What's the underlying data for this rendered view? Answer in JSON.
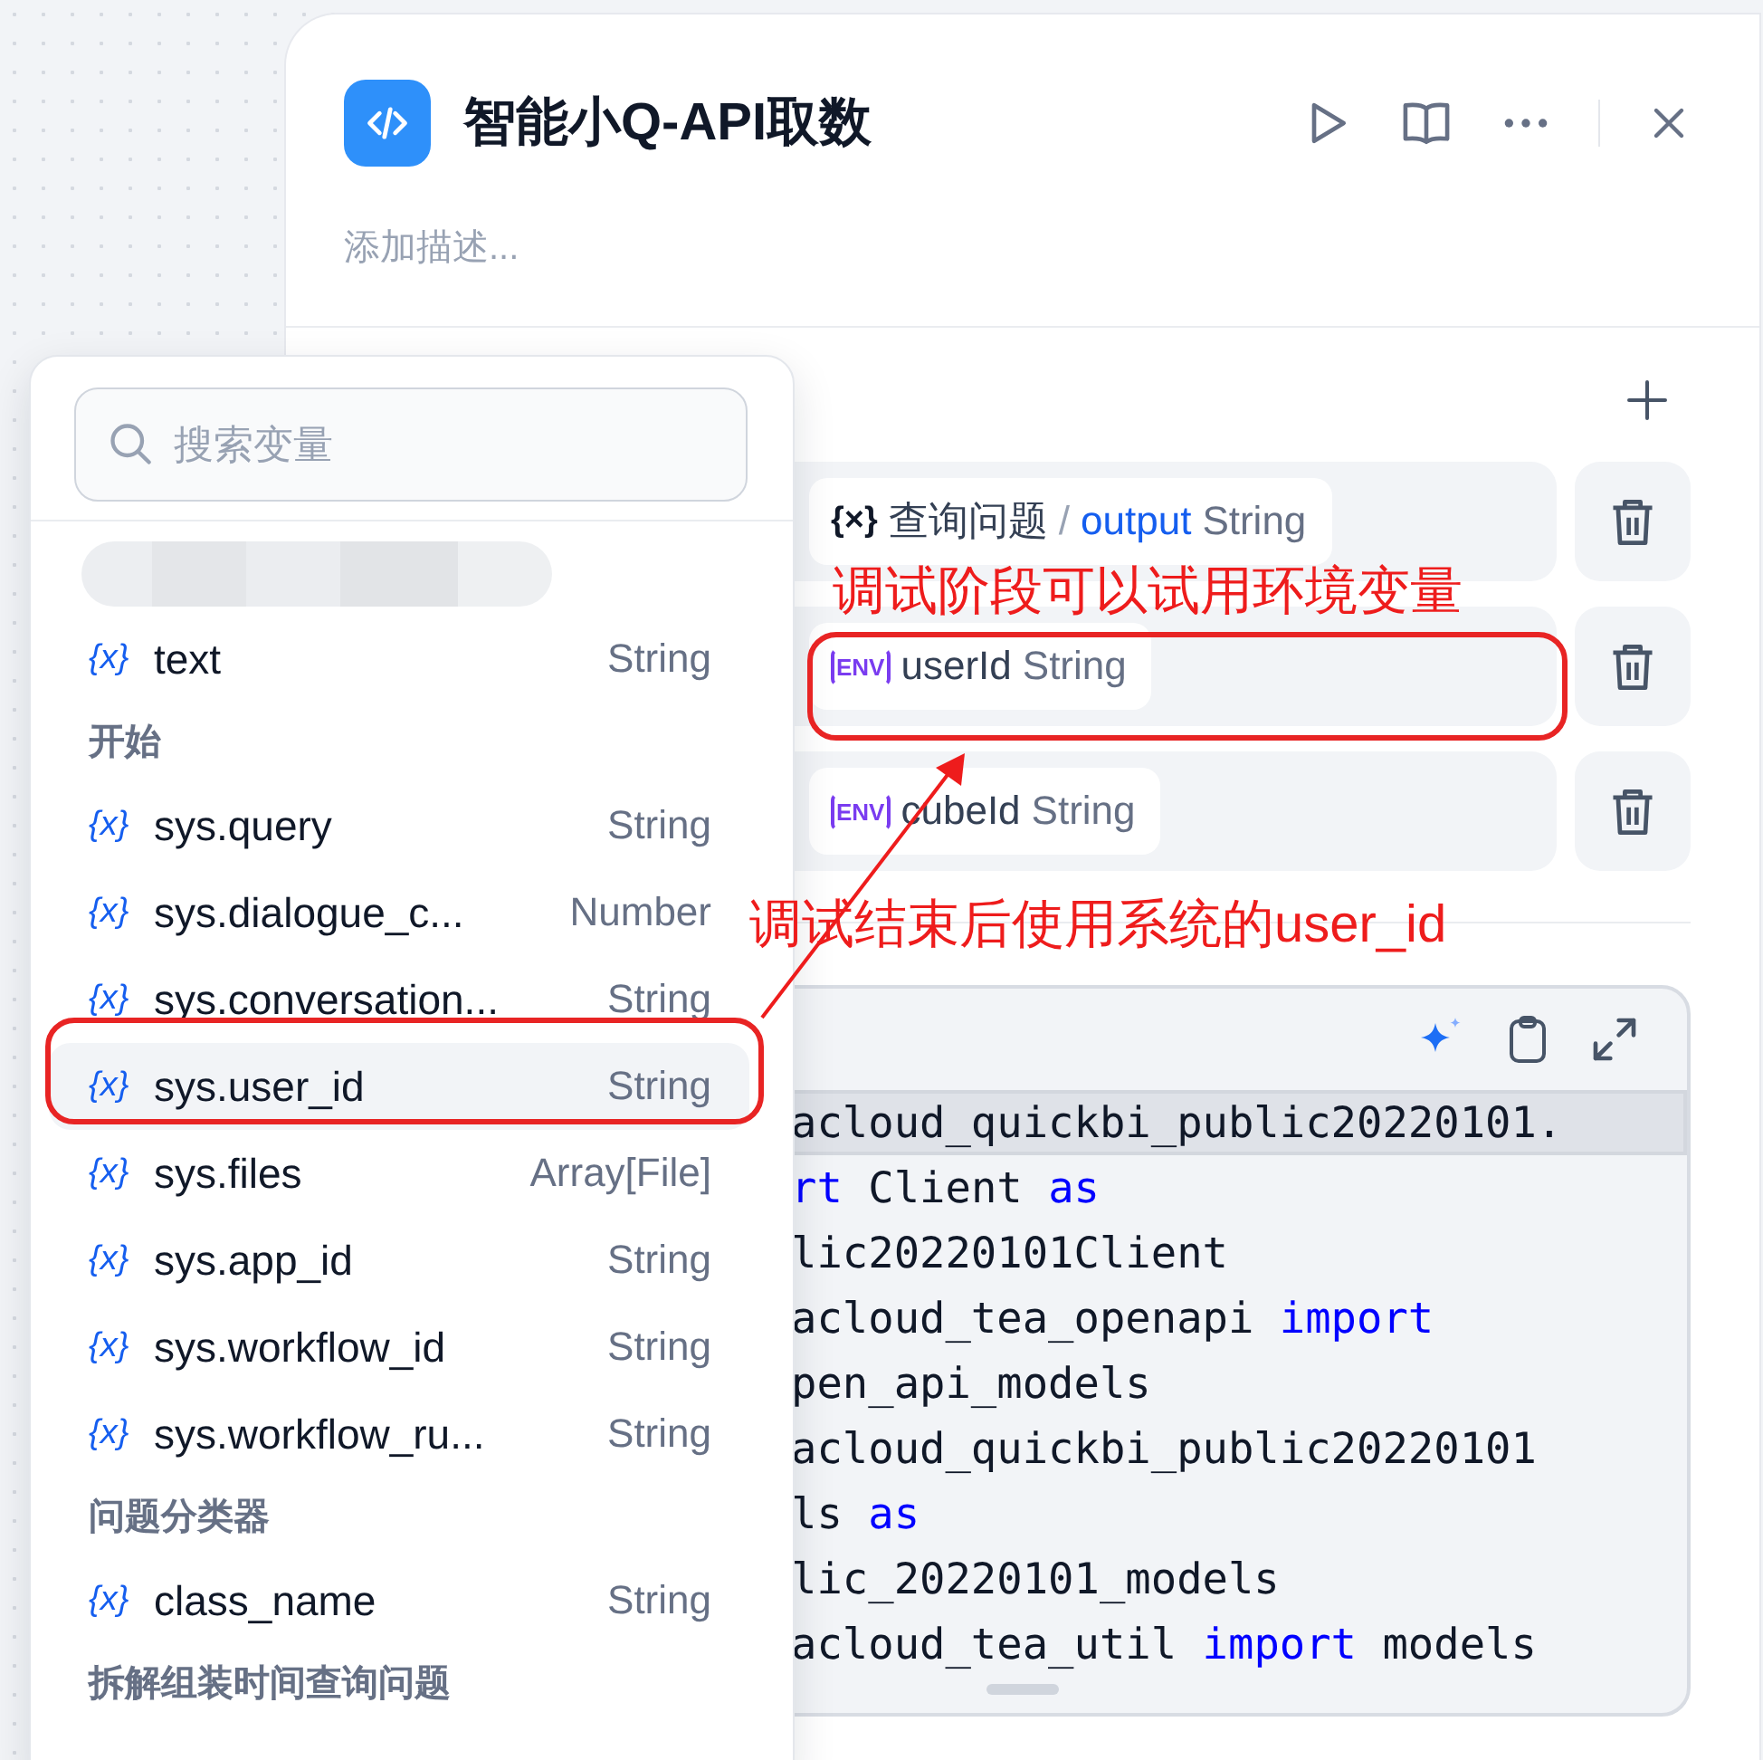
{
  "panel": {
    "title": "智能小Q-API取数",
    "description": {
      "placeholder": "添加描述..."
    }
  },
  "inputs": [
    {
      "kind": "reference",
      "icon": "{×}",
      "source": "查询问题",
      "separator": "/",
      "name": "output",
      "type": "String"
    },
    {
      "kind": "env",
      "icon": "ENV",
      "name": "userId",
      "type": "String"
    },
    {
      "kind": "env",
      "icon": "ENV",
      "name": "cubeId",
      "type": "String"
    }
  ],
  "code": {
    "lines": [
      {
        "active": true,
        "tokens": [
          {
            "kind": "plain",
            "text": "acloud_quickbi_public20220101."
          }
        ]
      },
      {
        "active": false,
        "tokens": [
          {
            "kind": "keyword",
            "text": "rt"
          },
          {
            "kind": "plain",
            "text": " Client "
          },
          {
            "kind": "keyword",
            "text": "as"
          }
        ]
      },
      {
        "active": false,
        "tokens": [
          {
            "kind": "plain",
            "text": "lic20220101Client"
          }
        ]
      },
      {
        "active": false,
        "tokens": [
          {
            "kind": "plain",
            "text": "acloud_tea_openapi "
          },
          {
            "kind": "keyword",
            "text": "import"
          }
        ]
      },
      {
        "active": false,
        "tokens": [
          {
            "kind": "plain",
            "text": "pen_api_models"
          }
        ]
      },
      {
        "active": false,
        "tokens": [
          {
            "kind": "plain",
            "text": "acloud_quickbi_public20220101"
          }
        ]
      },
      {
        "active": false,
        "tokens": [
          {
            "kind": "plain",
            "text": "ls "
          },
          {
            "kind": "keyword",
            "text": "as"
          }
        ]
      },
      {
        "active": false,
        "tokens": [
          {
            "kind": "plain",
            "text": "lic_20220101_models"
          }
        ]
      },
      {
        "active": false,
        "tokens": [
          {
            "kind": "plain",
            "text": "acloud_tea_util "
          },
          {
            "kind": "keyword",
            "text": "import"
          },
          {
            "kind": "plain",
            "text": " models"
          }
        ]
      }
    ]
  },
  "variable_menu": {
    "search": {
      "placeholder": "搜索变量"
    },
    "items": [
      {
        "kind": "redacted"
      },
      {
        "kind": "variable",
        "icon": "{x}",
        "name": "text",
        "type": "String",
        "selected": false
      },
      {
        "kind": "group",
        "label": "开始"
      },
      {
        "kind": "variable",
        "icon": "{x}",
        "name": "sys.query",
        "type": "String",
        "selected": false
      },
      {
        "kind": "variable",
        "icon": "{x}",
        "name": "sys.dialogue_c...",
        "type": "Number",
        "selected": false
      },
      {
        "kind": "variable",
        "icon": "{x}",
        "name": "sys.conversation...",
        "type": "String",
        "selected": false
      },
      {
        "kind": "variable",
        "icon": "{x}",
        "name": "sys.user_id",
        "type": "String",
        "selected": true
      },
      {
        "kind": "variable",
        "icon": "{x}",
        "name": "sys.files",
        "type": "Array[File]",
        "selected": false
      },
      {
        "kind": "variable",
        "icon": "{x}",
        "name": "sys.app_id",
        "type": "String",
        "selected": false
      },
      {
        "kind": "variable",
        "icon": "{x}",
        "name": "sys.workflow_id",
        "type": "String",
        "selected": false
      },
      {
        "kind": "variable",
        "icon": "{x}",
        "name": "sys.workflow_ru...",
        "type": "String",
        "selected": false
      },
      {
        "kind": "group",
        "label": "问题分类器"
      },
      {
        "kind": "variable",
        "icon": "{x}",
        "name": "class_name",
        "type": "String",
        "selected": false
      },
      {
        "kind": "group",
        "label": "拆解组装时间查询问题"
      }
    ]
  },
  "annotations": [
    {
      "kind": "label",
      "text": "调试阶段可以试用环境变量"
    },
    {
      "kind": "box"
    },
    {
      "kind": "arrow"
    },
    {
      "kind": "label",
      "text": "调试结束后使用系统的user_id"
    },
    {
      "kind": "box"
    }
  ]
}
